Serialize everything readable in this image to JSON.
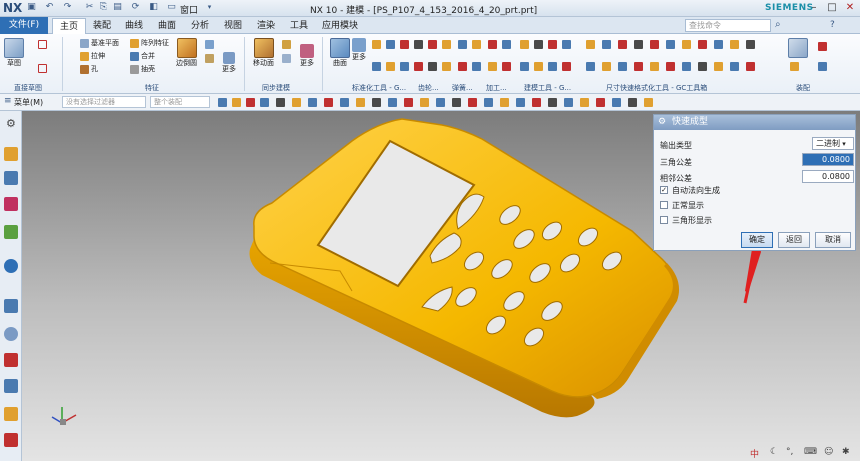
{
  "app": {
    "logo": "NX",
    "window_title": "NX 10 - 建模 - [PS_P107_4_153_2016_4_20_prt.prt]",
    "window_menu": "窗口",
    "brand": "SIEMENS"
  },
  "tabs": [
    "文件(F)",
    "主页",
    "装配",
    "曲线",
    "曲面",
    "分析",
    "视图",
    "渲染",
    "工具",
    "应用模块"
  ],
  "active_tab": "主页",
  "search": {
    "placeholder": "查找命令"
  },
  "ribbon": {
    "sketch": "草图",
    "datum_plane": "基准平面",
    "pattern_feature": "阵列特征",
    "extrude": "拉伸",
    "unite": "合并",
    "hole": "孔",
    "shell": "抽壳",
    "edge_blend": "边倒圆",
    "more1": "更多",
    "move_face": "移动面",
    "more2": "更多",
    "surface": "曲面",
    "more3": "更多",
    "groups": {
      "direct_sketch": "直接草图",
      "feature": "特征",
      "sync_modeling": "同步建模",
      "standard_tools": "标准化工具 - G...",
      "gear": "齿轮...",
      "spring": "弹簧...",
      "machining": "加工...",
      "modeling_tools": "建模工具 - G...",
      "dimension_tools": "尺寸快速格式化工具 - GC工具箱",
      "assembly": "装配"
    }
  },
  "selbar": {
    "menu": "菜单(M)",
    "filter": "没有选择过滤器",
    "scope": "整个装配"
  },
  "dialog": {
    "title": "快速成型",
    "output_type_label": "输出类型",
    "output_type_value": "二进制",
    "triangle_tol_label": "三角公差",
    "triangle_tol_value": "0.0800",
    "adjacent_tol_label": "相邻公差",
    "adjacent_tol_value": "0.0800",
    "auto_normal": "自动法向生成",
    "normal_display": "正常显示",
    "triangle_display": "三角形显示",
    "ok": "确定",
    "back": "返回",
    "cancel": "取消"
  },
  "systray": {
    "ime": "中"
  },
  "colors": {
    "accent": "#2e6fb5",
    "model": "#f5b800",
    "annotation_arrow": "#e02020"
  }
}
